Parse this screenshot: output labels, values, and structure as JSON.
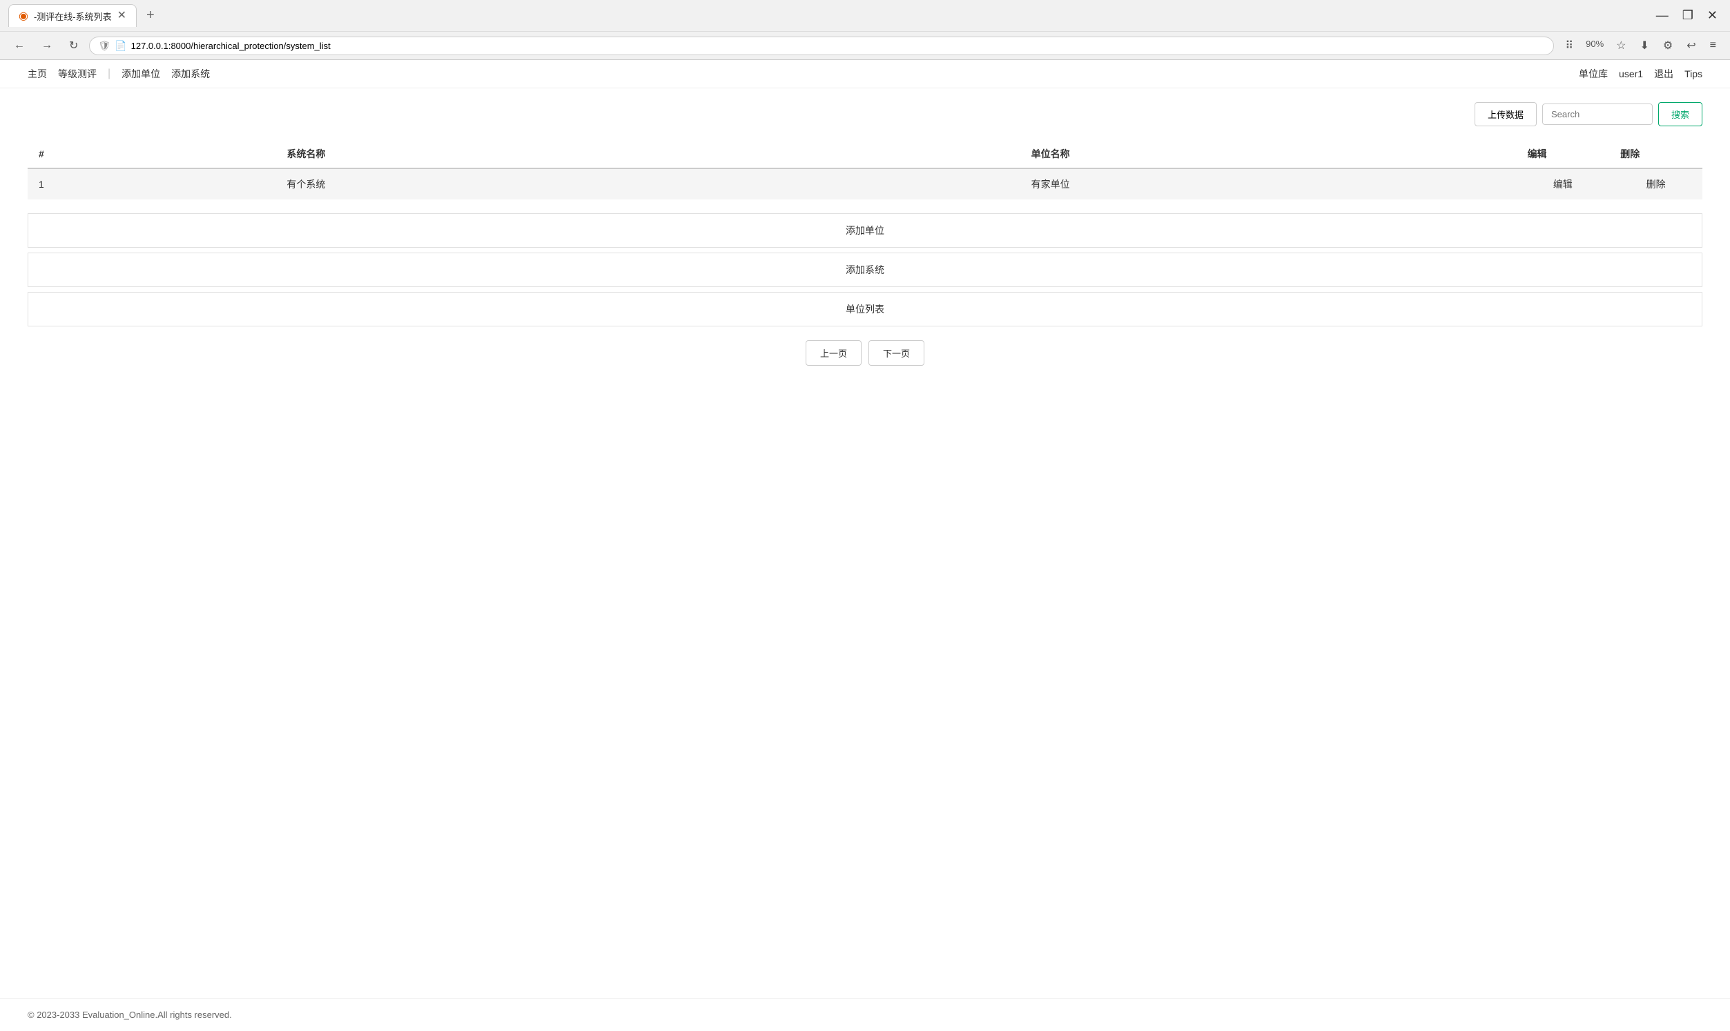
{
  "browser": {
    "tab_title": "-测评在线-系统列表",
    "tab_favicon": "◉",
    "url": "127.0.0.1:8000/hierarchical_protection/system_list",
    "zoom": "90%"
  },
  "nav": {
    "links": [
      {
        "label": "主页",
        "id": "home"
      },
      {
        "label": "等级测评",
        "id": "grade-eval"
      },
      {
        "label": "添加单位",
        "id": "add-unit"
      },
      {
        "label": "添加系统",
        "id": "add-system"
      }
    ],
    "actions": [
      {
        "label": "单位库",
        "id": "unit-library"
      },
      {
        "label": "user1",
        "id": "user"
      },
      {
        "label": "退出",
        "id": "logout"
      },
      {
        "label": "Tips",
        "id": "tips"
      }
    ]
  },
  "toolbar": {
    "upload_label": "上传数据",
    "search_placeholder": "Search",
    "search_btn_label": "搜索"
  },
  "table": {
    "columns": [
      "#",
      "系统名称",
      "单位名称",
      "编辑",
      "删除"
    ],
    "rows": [
      {
        "num": "1",
        "system_name": "有个系统",
        "unit_name": "有家单位",
        "edit": "编辑",
        "delete": "删除"
      }
    ]
  },
  "quick_actions": [
    {
      "label": "添加单位"
    },
    {
      "label": "添加系统"
    },
    {
      "label": "单位列表"
    }
  ],
  "pagination": {
    "prev": "上一页",
    "next": "下一页"
  },
  "footer": {
    "copyright": "© 2023-2033 Evaluation_Online.All rights reserved."
  }
}
